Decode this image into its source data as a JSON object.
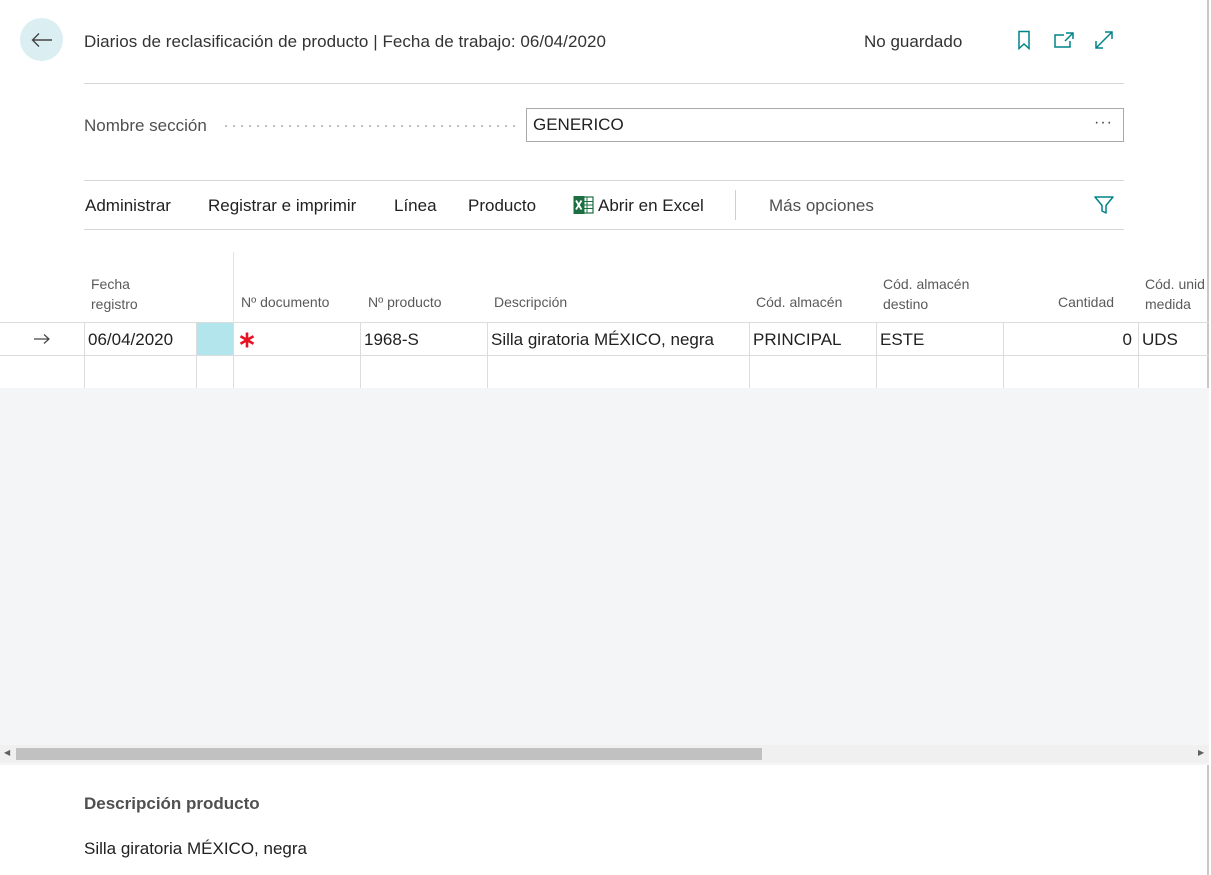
{
  "header": {
    "title": "Diarios de reclasificación de producto | Fecha de trabajo: 06/04/2020",
    "status": "No guardado",
    "icons": [
      "arrow-left-icon",
      "bookmark-icon",
      "open-new-window-icon",
      "expand-icon"
    ]
  },
  "section": {
    "label": "Nombre sección",
    "value": "GENERICO",
    "more": "···"
  },
  "actions": {
    "administrar": "Administrar",
    "registrar": "Registrar e imprimir",
    "linea": "Línea",
    "producto": "Producto",
    "excel": "Abrir en Excel",
    "mas": "Más opciones",
    "filter_icon": "filter-icon"
  },
  "grid": {
    "columns": {
      "fecha_l1": "Fecha",
      "fecha_l2": "registro",
      "documento": "Nº documento",
      "producto": "Nº producto",
      "descripcion": "Descripción",
      "almacen": "Cód. almacén",
      "almacen_destino_l1": "Cód. almacén",
      "almacen_destino_l2": "destino",
      "cantidad": "Cantidad",
      "unidad_l1": "Cód. unid",
      "unidad_l2": "medida"
    },
    "rows": [
      {
        "fecha": "06/04/2020",
        "documento_required": "required-asterisk-icon",
        "producto": "1968-S",
        "descripcion": "Silla giratoria MÉXICO, negra",
        "almacen": "PRINCIPAL",
        "almacen_destino": "ESTE",
        "cantidad": "0",
        "unidad": "UDS"
      }
    ]
  },
  "factbox": {
    "title": "Descripción producto",
    "value": "Silla giratoria MÉXICO, negra"
  },
  "colors": {
    "accent": "#008489",
    "selected_cell": "#b3e5ec",
    "required": "#e81123",
    "excel_green": "#1d6f42",
    "grid_bg": "#f4f5f7"
  }
}
